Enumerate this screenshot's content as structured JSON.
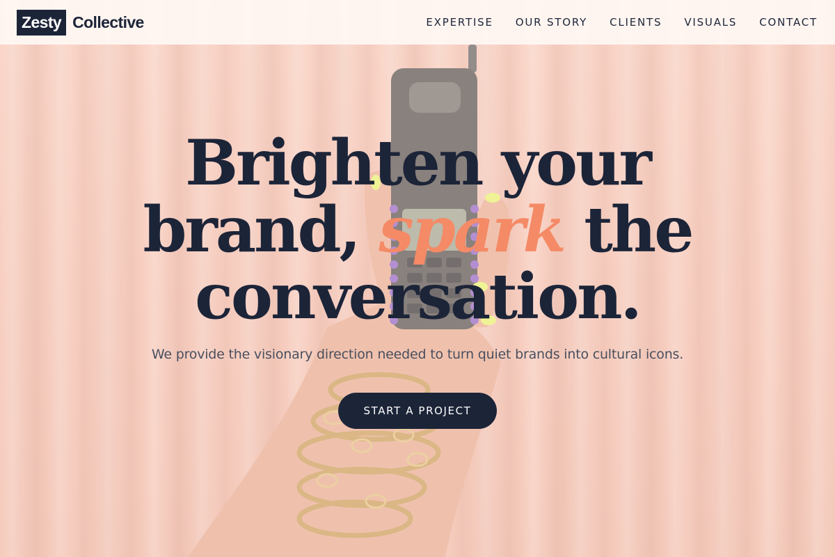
{
  "brand": {
    "logo_box": "Zesty",
    "logo_word": "Collective"
  },
  "nav": {
    "items": [
      {
        "label": "EXPERTISE"
      },
      {
        "label": "OUR STORY"
      },
      {
        "label": "CLIENTS"
      },
      {
        "label": "VISUALS"
      },
      {
        "label": "CONTACT"
      }
    ]
  },
  "hero": {
    "headline_line1": "Brighten your",
    "headline_line2_start": "brand,",
    "headline_accent": "spark",
    "headline_line2_end": "the",
    "headline_line3": "conversation.",
    "subheading": "We provide the visionary direction needed to turn quiet brands into cultural icons.",
    "cta_label": "START A PROJECT",
    "background_image": "hand-holding-mobile-phone-illustration"
  },
  "colors": {
    "navy": "#1c2438",
    "accent": "#f58a66",
    "background": "#f6c6b6"
  }
}
